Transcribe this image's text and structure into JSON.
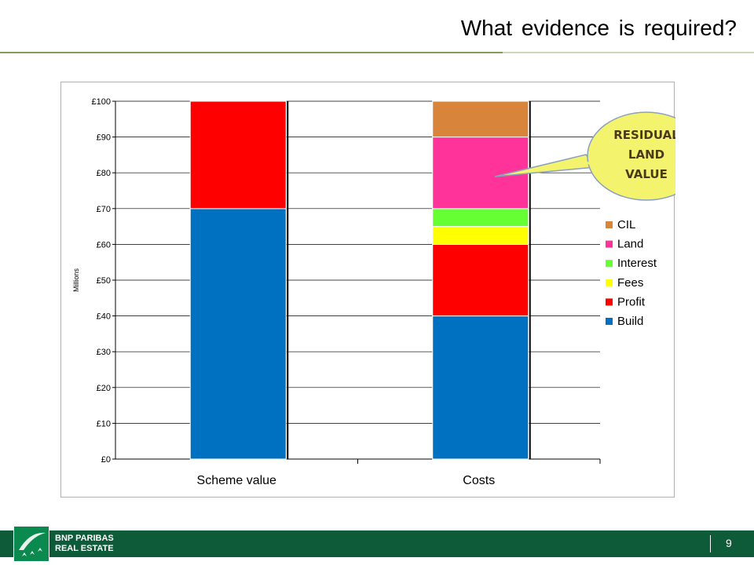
{
  "slide": {
    "title": "What evidence  is required?",
    "page_number": "9"
  },
  "footer": {
    "brand_line1": "BNP PARIBAS",
    "brand_line2": "REAL ESTATE",
    "logo_icon": "bnp-stars-icon"
  },
  "chart_data": {
    "type": "bar",
    "stacked": true,
    "categories": [
      "Scheme value",
      "Costs"
    ],
    "ylabel": "Millions",
    "ylim": [
      0,
      100
    ],
    "yticks": [
      0,
      10,
      20,
      30,
      40,
      50,
      60,
      70,
      80,
      90,
      100
    ],
    "ytick_labels": [
      "£0",
      "£10",
      "£20",
      "£30",
      "£40",
      "£50",
      "£60",
      "£70",
      "£80",
      "£90",
      "£100"
    ],
    "grid": true,
    "legend_position": "right",
    "series": [
      {
        "name": "Build",
        "color": "#0070c0",
        "values": [
          70,
          40
        ]
      },
      {
        "name": "Profit",
        "color": "#ff0000",
        "values": [
          30,
          20
        ]
      },
      {
        "name": "Fees",
        "color": "#ffff00",
        "values": [
          0,
          5
        ]
      },
      {
        "name": "Interest",
        "color": "#66ff33",
        "values": [
          0,
          5
        ]
      },
      {
        "name": "Land",
        "color": "#ff3399",
        "values": [
          0,
          20
        ]
      },
      {
        "name": "CIL",
        "color": "#d9843b",
        "values": [
          0,
          10
        ]
      }
    ],
    "legend_order": [
      "CIL",
      "Land",
      "Interest",
      "Fees",
      "Profit",
      "Build"
    ],
    "annotation": {
      "lines": [
        "RESIDUAL",
        "LAND",
        "VALUE"
      ],
      "fill": "#f3f36e",
      "stroke": "#8aa0bf",
      "points_to_series": "Land"
    }
  }
}
